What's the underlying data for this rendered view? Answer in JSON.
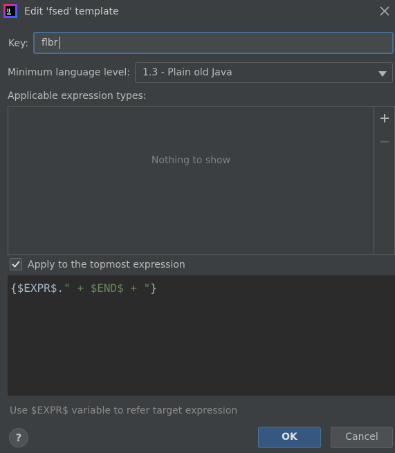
{
  "window": {
    "title": "Edit 'fsed' template",
    "app_icon": "intellij-idea-icon",
    "close_icon": "close-icon"
  },
  "key": {
    "label": "Key:",
    "value": "flbr"
  },
  "language_level": {
    "label": "Minimum language level:",
    "selected": "1.3 - Plain old Java",
    "arrow_icon": "chevron-down-icon"
  },
  "expression_types": {
    "label": "Applicable expression types:",
    "empty_text": "Nothing to show",
    "add_icon": "plus-icon",
    "remove_icon": "minus-icon"
  },
  "topmost": {
    "label": "Apply to the topmost expression",
    "checked": true
  },
  "editor": {
    "tokens": [
      {
        "text": "{$EXPR$.",
        "kind": "plain"
      },
      {
        "text": "\" + $END$ + \"",
        "kind": "string"
      },
      {
        "text": "}",
        "kind": "plain"
      }
    ]
  },
  "hint": "Use $EXPR$ variable to refer target expression",
  "footer": {
    "help_label": "?",
    "ok_label": "OK",
    "cancel_label": "Cancel"
  },
  "colors": {
    "background": "#3c3f41",
    "editor_background": "#2b2b2b",
    "accent": "#365880",
    "focus_border": "#466d94",
    "string_token": "#6a8759",
    "code_text": "#a9b7c6"
  }
}
